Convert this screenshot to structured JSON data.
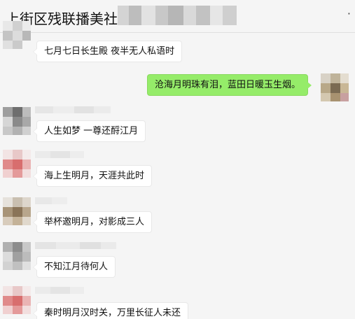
{
  "header": {
    "title": "上街区残联播美社工",
    "more_icon": "more-dots-icon"
  },
  "messages": [
    {
      "side": "left",
      "text": "七月七日长生殿 夜半无人私语时"
    },
    {
      "side": "right",
      "text": "沧海月明珠有泪，蓝田日暖玉生烟。"
    },
    {
      "side": "left",
      "text": "人生如梦 一尊还酹江月"
    },
    {
      "side": "left",
      "text": "海上生明月，天涯共此时"
    },
    {
      "side": "left",
      "text": "举杯邀明月，对影成三人"
    },
    {
      "side": "left",
      "text": "不知江月待何人"
    },
    {
      "side": "left",
      "text": "秦时明月汉时关，万里长征人未还"
    }
  ],
  "colors": {
    "background": "#f5f5f5",
    "bubble_left": "#ffffff",
    "bubble_right": "#95ec69"
  }
}
